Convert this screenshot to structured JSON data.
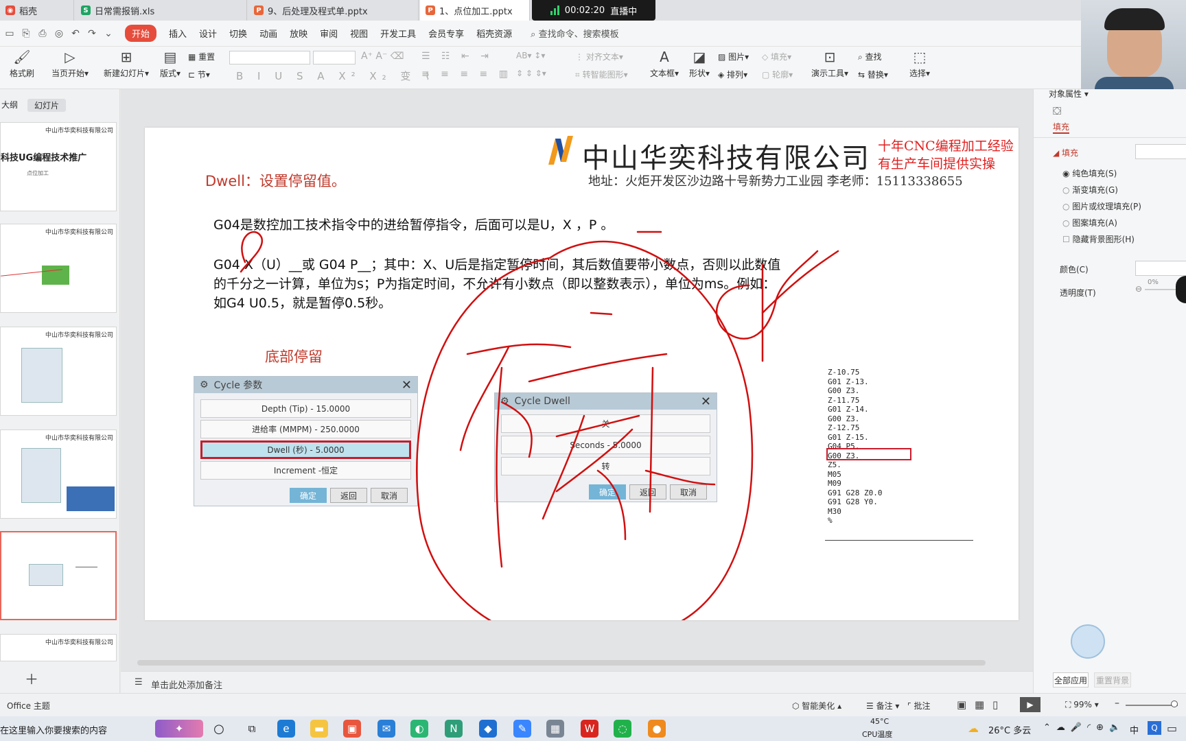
{
  "tabs": [
    {
      "label": "稻壳",
      "icon": "docer-icon"
    },
    {
      "label": "日常需报销.xls",
      "icon": "spreadsheet-icon"
    },
    {
      "label": "9、后处理及程式单.pptx",
      "icon": "presentation-icon"
    },
    {
      "label": "1、点位加工.pptx",
      "icon": "presentation-icon"
    }
  ],
  "live": {
    "time": "00:02:20",
    "status": "直播中"
  },
  "menu": [
    "开始",
    "插入",
    "设计",
    "切换",
    "动画",
    "放映",
    "审阅",
    "视图",
    "开发工具",
    "会员专享",
    "稻壳资源"
  ],
  "search_placeholder": "查找命令、搜索模板",
  "ribbon": {
    "format_painter": "格式刷",
    "play_from_current": "当页开始",
    "new_slide": "新建幻灯片",
    "layout": "版式",
    "section": "节",
    "reset": "重置",
    "align_text": "对齐文本",
    "smart_art": "转智能图形",
    "textbox": "文本框",
    "shape": "形状",
    "picture": "图片",
    "arrange": "排列",
    "fill": "填充",
    "outline": "轮廓",
    "presenter": "演示工具",
    "find": "查找",
    "replace": "替换",
    "select": "选择"
  },
  "left_tabs": [
    "大纲",
    "幻灯片"
  ],
  "thumb1": {
    "title": "科技UG编程技术推广",
    "sub": "点位加工"
  },
  "thumb_company": "中山市华奕科技有限公司",
  "add_note": "单击此处添加备注",
  "slide": {
    "company": "中山华奕科技有限公司",
    "slogan1": "十年CNC编程加工经验",
    "slogan2": "有生产车间提供实操",
    "address": "地址：火炬开发区沙边路十号新势力工业园  李老师：15113338655",
    "heading": "Dwell：设置停留值。",
    "para1": "G04是数控加工技术指令中的进给暂停指令，后面可以是U，X ，P 。",
    "para2a": "G04 X（U）__或 G04 P__；其中：X、U后是指定暂停时间，其后数值要带小数点，否则以此数值",
    "para2b": "的千分之一计算，单位为s；P为指定时间，不允许有小数点（即以整数表示），单位为ms。例如：",
    "para2c": "如G4 U0.5，就是暂停0.5秒。",
    "bottom_dwell": "底部停留",
    "dialog1": {
      "title": "Cycle 参数",
      "rows": [
        "Depth (Tip) - 15.0000",
        "进给率 (MMPM) - 250.0000",
        "Dwell (秒) - 5.0000",
        "Increment -恒定"
      ],
      "ok": "确定",
      "back": "返回",
      "cancel": "取消"
    },
    "dialog2": {
      "title": "Cycle Dwell",
      "rows": [
        "关",
        "Seconds - 5.0000",
        "转"
      ],
      "ok": "确定",
      "back": "返回",
      "cancel": "取消"
    },
    "code": [
      "Z-10.75",
      "G01 Z-13.",
      "G00 Z3.",
      "Z-11.75",
      "G01 Z-14.",
      "G00 Z3.",
      "Z-12.75",
      "G01 Z-15.",
      "G04 P5.",
      "G00 Z3.",
      "Z5.",
      "M05",
      "M09",
      "G91 G28 Z0.0",
      "G91 G28 Y0.",
      "M30",
      "%"
    ]
  },
  "right": {
    "header": "对象属性",
    "tab": "填充",
    "section": "填充",
    "options": [
      "纯色填充(S)",
      "渐变填充(G)",
      "图片或纹理填充(P)",
      "图案填充(A)"
    ],
    "hide_bg": "隐藏背景图形(H)",
    "color": "颜色(C)",
    "transparency": "透明度(T)",
    "transparency_value": "0%",
    "apply_all": "全部应用",
    "reset_bg": "重置背景"
  },
  "status": {
    "theme": "Office 主题",
    "beautify": "智能美化",
    "notes": "备注",
    "comment": "批注",
    "zoom": "99%"
  },
  "taskbar": {
    "search": "在这里输入你要搜索的内容",
    "cpu_temp": "45°C",
    "cpu_label": "CPU温度",
    "weather": "26°C  多云",
    "ime": "中"
  },
  "colors": {
    "accent": "#e64c3c",
    "slide_red": "#c0392b",
    "ink": "#d10f0f"
  }
}
